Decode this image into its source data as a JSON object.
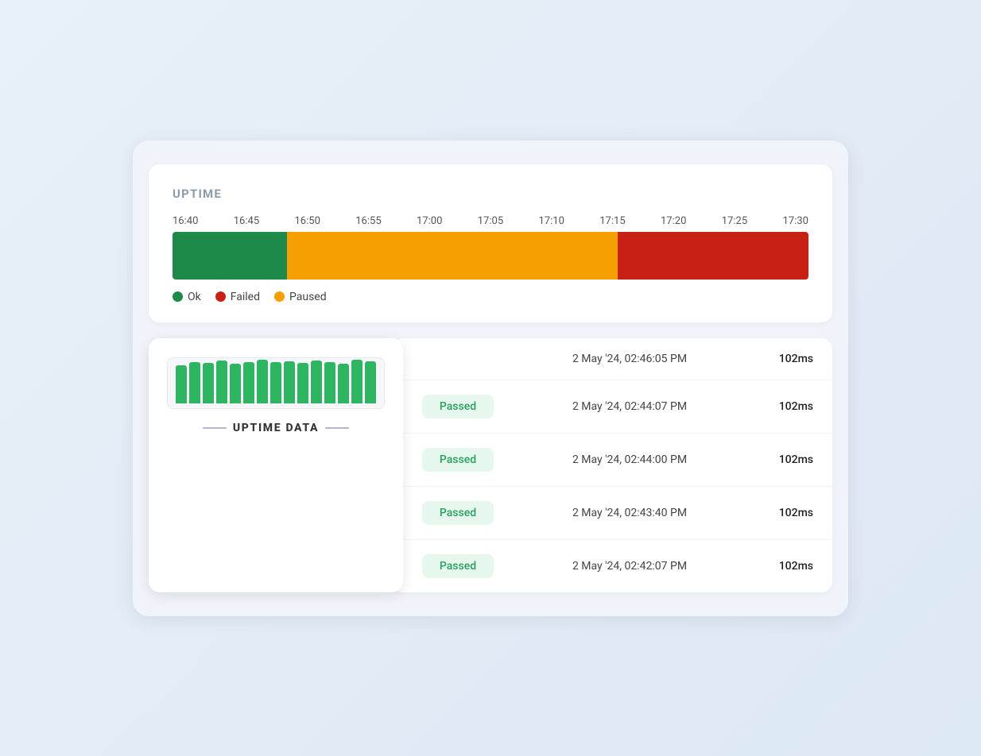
{
  "uptime": {
    "title": "UPTIME",
    "timeline": {
      "labels": [
        "16:40",
        "16:45",
        "16:50",
        "16:55",
        "17:00",
        "17:05",
        "17:10",
        "17:15",
        "17:20",
        "17:25",
        "17:30"
      ]
    },
    "legend": {
      "ok_label": "Ok",
      "failed_label": "Failed",
      "paused_label": "Paused"
    }
  },
  "uptime_data": {
    "title": "UPTIME DATA",
    "bars": [
      55,
      60,
      58,
      62,
      57,
      60,
      63,
      59,
      61,
      58,
      62,
      60,
      57,
      63,
      61
    ],
    "bar_color": "#2db562"
  },
  "table": {
    "top_row": {
      "timestamp": "2 May '24, 02:46:05 PM",
      "duration": "102ms"
    },
    "rows": [
      {
        "status": "Passed",
        "timestamp": "2 May '24, 02:44:07 PM",
        "duration": "102ms"
      },
      {
        "status": "Passed",
        "timestamp": "2 May '24, 02:44:00 PM",
        "duration": "102ms"
      },
      {
        "status": "Passed",
        "timestamp": "2 May '24, 02:43:40 PM",
        "duration": "102ms"
      },
      {
        "status": "Passed",
        "timestamp": "2 May '24, 02:42:07 PM",
        "duration": "102ms"
      }
    ]
  }
}
